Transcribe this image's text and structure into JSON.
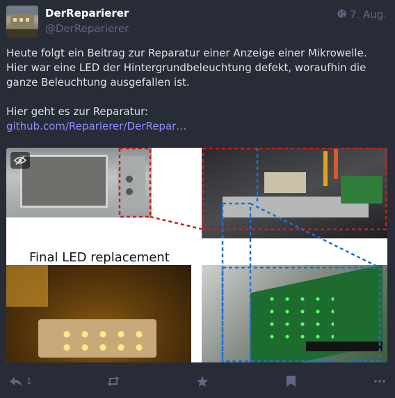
{
  "author": {
    "display_name": "DerReparierer",
    "account": "@DerReparierer"
  },
  "meta": {
    "visibility_icon": "globe-icon",
    "date": "7. Aug."
  },
  "content": {
    "paragraph1": "Heute folgt ein Beitrag zur Reparatur einer Anzeige einer Mikrowelle. Hier war eine LED der Hintergrundbeleuchtung defekt, woraufhin die ganze Beleuchtung ausgefallen ist.",
    "paragraph2_text": "Hier geht es zur Reparatur:",
    "link_text": "github.com/Reparierer/DerRepar…"
  },
  "media": {
    "caption": "Final LED replacement",
    "toggle_icon": "eye-slash-icon"
  },
  "actions": {
    "reply_count": "1",
    "reply_icon": "reply-icon",
    "boost_icon": "retweet-icon",
    "favourite_icon": "star-icon",
    "bookmark_icon": "bookmark-icon",
    "more_icon": "ellipsis-icon"
  },
  "colors": {
    "background": "#282c37",
    "link": "#8c8dff",
    "muted": "#606984",
    "highlight_red": "#cc1f1f",
    "highlight_blue": "#1f6fd6"
  }
}
